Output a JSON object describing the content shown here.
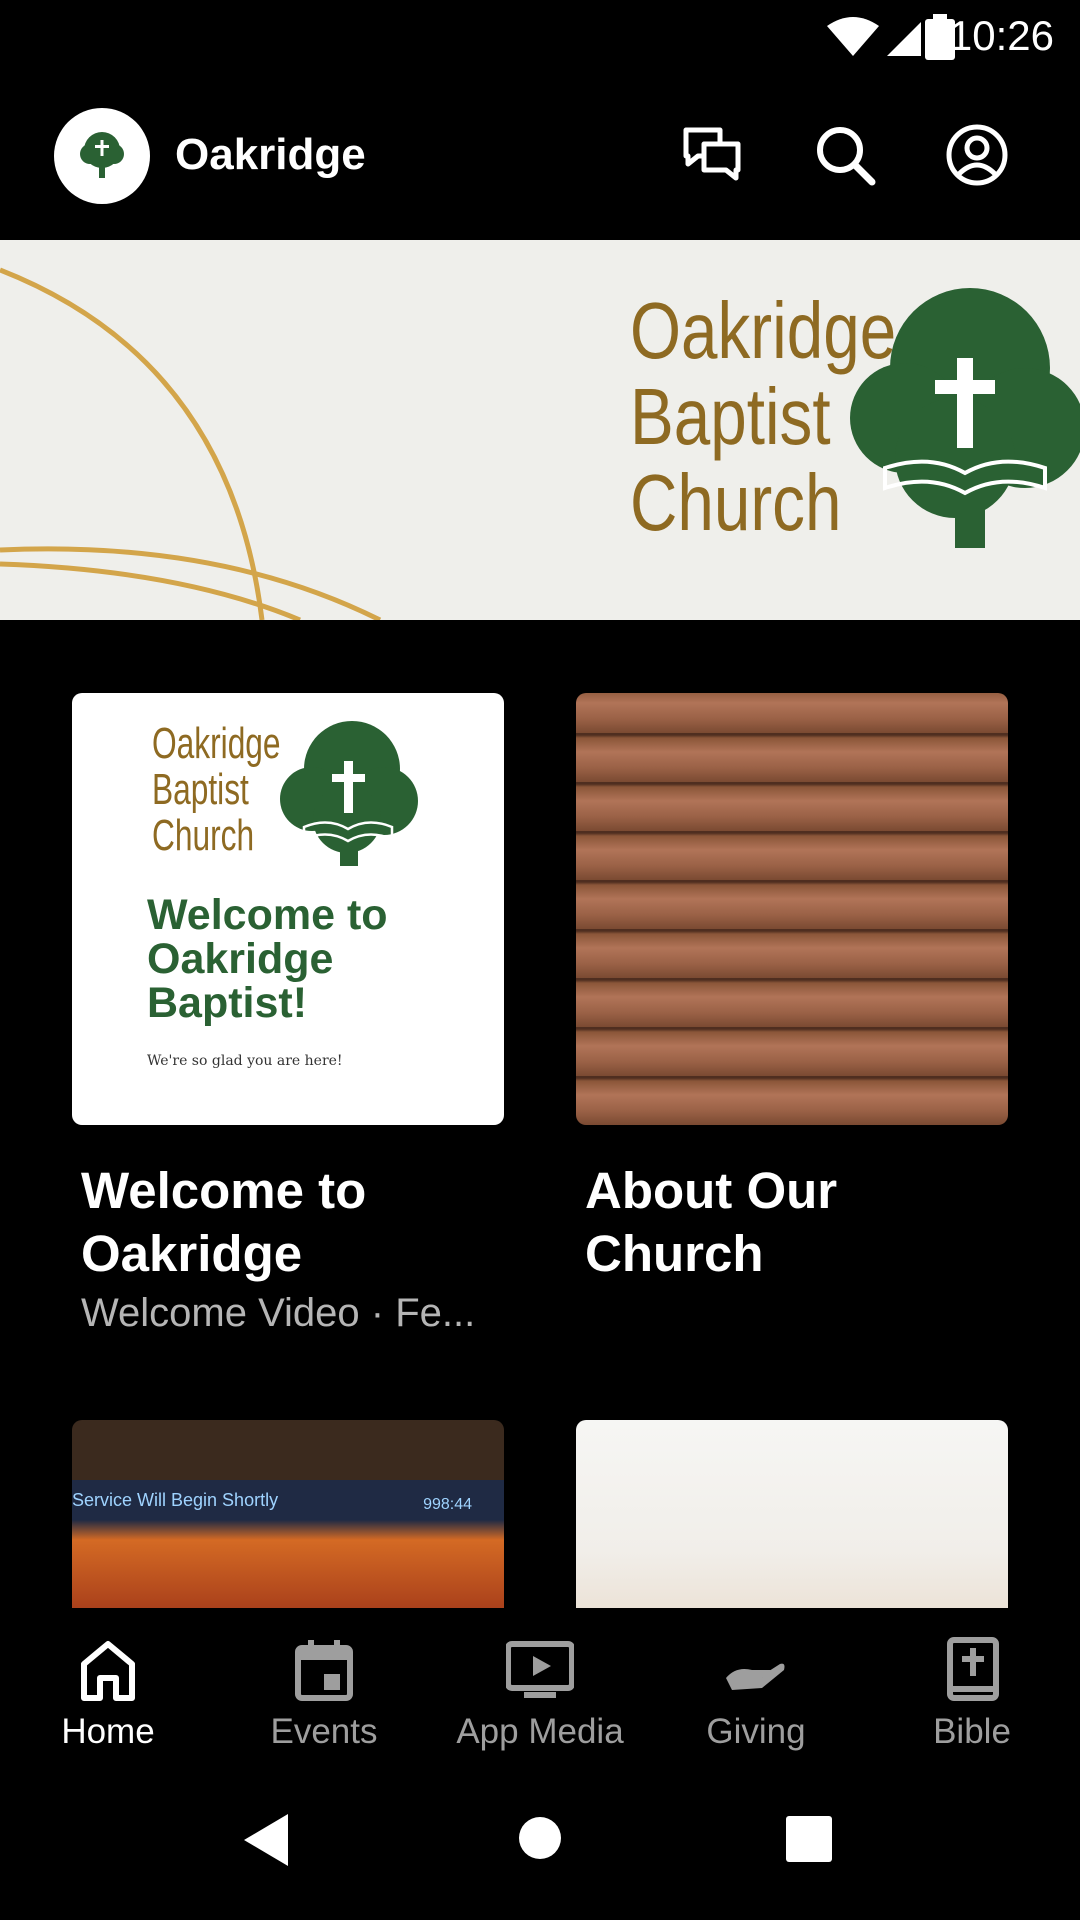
{
  "status_bar": {
    "time": "10:26"
  },
  "header": {
    "title": "Oakridge",
    "icons": [
      "chat-icon",
      "search-icon",
      "account-icon"
    ]
  },
  "banner": {
    "brand_lines": [
      "Oakridge",
      "Baptist",
      "Church"
    ]
  },
  "cards": [
    {
      "thumb_brand_lines": [
        "Oakridge",
        "Baptist",
        "Church"
      ],
      "thumb_heading_lines": [
        "Welcome to",
        "Oakridge",
        "Baptist!"
      ],
      "thumb_tagline": "We're so glad you are here!",
      "title": "Welcome to Oakridge",
      "subtitle": "Welcome Video · Fe..."
    },
    {
      "title": "About Our Church",
      "subtitle": ""
    }
  ],
  "row2_cards": [
    {
      "screen_text": "Service Will Begin Shortly",
      "screen_counter": "998:44"
    },
    {}
  ],
  "bottom_nav": {
    "items": [
      {
        "label": "Home",
        "icon": "home-icon",
        "active": true
      },
      {
        "label": "Events",
        "icon": "calendar-icon",
        "active": false
      },
      {
        "label": "App Media",
        "icon": "media-icon",
        "active": false
      },
      {
        "label": "Giving",
        "icon": "giving-icon",
        "active": false
      },
      {
        "label": "Bible",
        "icon": "bible-icon",
        "active": false
      }
    ]
  },
  "colors": {
    "brand_green": "#2a6133",
    "brand_gold": "#8e6a22",
    "inactive": "#9e9e9e"
  }
}
